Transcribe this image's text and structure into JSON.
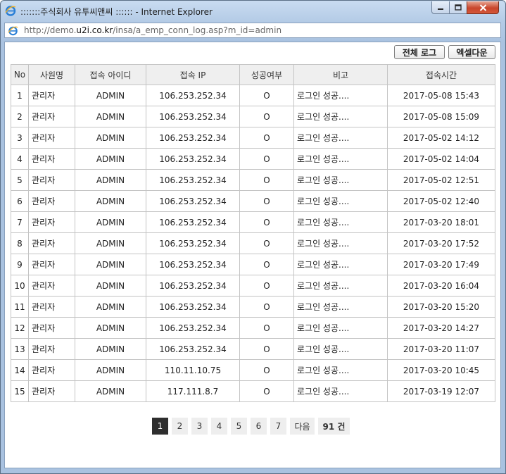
{
  "window": {
    "title": ":::::::주식회사 유투씨앤씨 :::::: - Internet Explorer",
    "url_prefix": "http://demo.",
    "url_domain": "u2i.co.kr",
    "url_path": "/insa/a_emp_conn_log.asp?m_id=admin"
  },
  "toolbar": {
    "all_log_label": "전체 로그",
    "excel_label": "엑셀다운"
  },
  "table": {
    "headers": [
      "No",
      "사원명",
      "접속 아이디",
      "접속 IP",
      "성공여부",
      "비고",
      "접속시간"
    ],
    "rows": [
      [
        "1",
        "관리자",
        "ADMIN",
        "106.253.252.34",
        "O",
        "로그인 성공....",
        "2017-05-08 15:43"
      ],
      [
        "2",
        "관리자",
        "ADMIN",
        "106.253.252.34",
        "O",
        "로그인 성공....",
        "2017-05-08 15:09"
      ],
      [
        "3",
        "관리자",
        "ADMIN",
        "106.253.252.34",
        "O",
        "로그인 성공....",
        "2017-05-02 14:12"
      ],
      [
        "4",
        "관리자",
        "ADMIN",
        "106.253.252.34",
        "O",
        "로그인 성공....",
        "2017-05-02 14:04"
      ],
      [
        "5",
        "관리자",
        "ADMIN",
        "106.253.252.34",
        "O",
        "로그인 성공....",
        "2017-05-02 12:51"
      ],
      [
        "6",
        "관리자",
        "ADMIN",
        "106.253.252.34",
        "O",
        "로그인 성공....",
        "2017-05-02 12:40"
      ],
      [
        "7",
        "관리자",
        "ADMIN",
        "106.253.252.34",
        "O",
        "로그인 성공....",
        "2017-03-20 18:01"
      ],
      [
        "8",
        "관리자",
        "ADMIN",
        "106.253.252.34",
        "O",
        "로그인 성공....",
        "2017-03-20 17:52"
      ],
      [
        "9",
        "관리자",
        "ADMIN",
        "106.253.252.34",
        "O",
        "로그인 성공....",
        "2017-03-20 17:49"
      ],
      [
        "10",
        "관리자",
        "ADMIN",
        "106.253.252.34",
        "O",
        "로그인 성공....",
        "2017-03-20 16:04"
      ],
      [
        "11",
        "관리자",
        "ADMIN",
        "106.253.252.34",
        "O",
        "로그인 성공....",
        "2017-03-20 15:20"
      ],
      [
        "12",
        "관리자",
        "ADMIN",
        "106.253.252.34",
        "O",
        "로그인 성공....",
        "2017-03-20 14:27"
      ],
      [
        "13",
        "관리자",
        "ADMIN",
        "106.253.252.34",
        "O",
        "로그인 성공....",
        "2017-03-20 11:07"
      ],
      [
        "14",
        "관리자",
        "ADMIN",
        "110.11.10.75",
        "O",
        "로그인 성공....",
        "2017-03-20 10:45"
      ],
      [
        "15",
        "관리자",
        "ADMIN",
        "117.111.8.7",
        "O",
        "로그인 성공....",
        "2017-03-19 12:07"
      ]
    ]
  },
  "pagination": {
    "pages": [
      "1",
      "2",
      "3",
      "4",
      "5",
      "6",
      "7"
    ],
    "current": "1",
    "next_label": "다음",
    "total_label": "91 건"
  }
}
